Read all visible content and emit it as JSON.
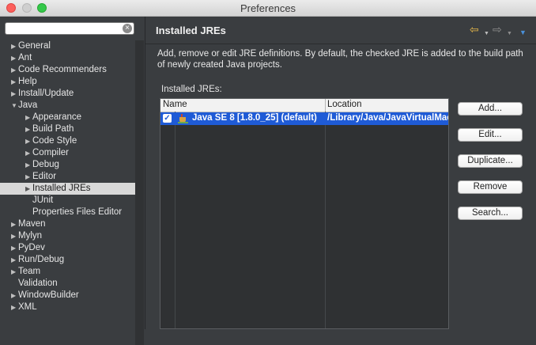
{
  "window": {
    "title": "Preferences"
  },
  "sidebar": {
    "filter_placeholder": "",
    "items": [
      {
        "label": "General",
        "level": 0,
        "expandable": true,
        "expanded": false
      },
      {
        "label": "Ant",
        "level": 0,
        "expandable": true,
        "expanded": false
      },
      {
        "label": "Code Recommenders",
        "level": 0,
        "expandable": true,
        "expanded": false
      },
      {
        "label": "Help",
        "level": 0,
        "expandable": true,
        "expanded": false
      },
      {
        "label": "Install/Update",
        "level": 0,
        "expandable": true,
        "expanded": false
      },
      {
        "label": "Java",
        "level": 0,
        "expandable": true,
        "expanded": true
      },
      {
        "label": "Appearance",
        "level": 1,
        "expandable": true,
        "expanded": false
      },
      {
        "label": "Build Path",
        "level": 1,
        "expandable": true,
        "expanded": false
      },
      {
        "label": "Code Style",
        "level": 1,
        "expandable": true,
        "expanded": false
      },
      {
        "label": "Compiler",
        "level": 1,
        "expandable": true,
        "expanded": false
      },
      {
        "label": "Debug",
        "level": 1,
        "expandable": true,
        "expanded": false
      },
      {
        "label": "Editor",
        "level": 1,
        "expandable": true,
        "expanded": false
      },
      {
        "label": "Installed JREs",
        "level": 1,
        "expandable": true,
        "expanded": false,
        "selected": true
      },
      {
        "label": "JUnit",
        "level": 1,
        "expandable": false
      },
      {
        "label": "Properties Files Editor",
        "level": 1,
        "expandable": false
      },
      {
        "label": "Maven",
        "level": 0,
        "expandable": true,
        "expanded": false
      },
      {
        "label": "Mylyn",
        "level": 0,
        "expandable": true,
        "expanded": false
      },
      {
        "label": "PyDev",
        "level": 0,
        "expandable": true,
        "expanded": false
      },
      {
        "label": "Run/Debug",
        "level": 0,
        "expandable": true,
        "expanded": false
      },
      {
        "label": "Team",
        "level": 0,
        "expandable": true,
        "expanded": false
      },
      {
        "label": "Validation",
        "level": 0,
        "expandable": false
      },
      {
        "label": "WindowBuilder",
        "level": 0,
        "expandable": true,
        "expanded": false
      },
      {
        "label": "XML",
        "level": 0,
        "expandable": true,
        "expanded": false
      }
    ]
  },
  "page": {
    "title": "Installed JREs",
    "description": "Add, remove or edit JRE definitions. By default, the checked JRE is added to the build path of newly created Java projects.",
    "table_label": "Installed JREs:",
    "columns": [
      "Name",
      "Location"
    ],
    "rows": [
      {
        "checked": true,
        "name": "Java SE 8 [1.8.0_25] (default)",
        "location": "/Library/Java/JavaVirtualMac"
      }
    ],
    "buttons": {
      "add": "Add...",
      "edit": "Edit...",
      "duplicate": "Duplicate...",
      "remove": "Remove",
      "search": "Search..."
    }
  },
  "icons": {
    "back": "arrow-left-icon",
    "forward": "arrow-right-icon",
    "view_menu": "triangle-down-icon",
    "jre": "java-cup-icon",
    "checkbox": "checkmark-icon"
  },
  "colors": {
    "selection_blue": "#1f5bd6",
    "back_arrow": "#e7b84a"
  }
}
